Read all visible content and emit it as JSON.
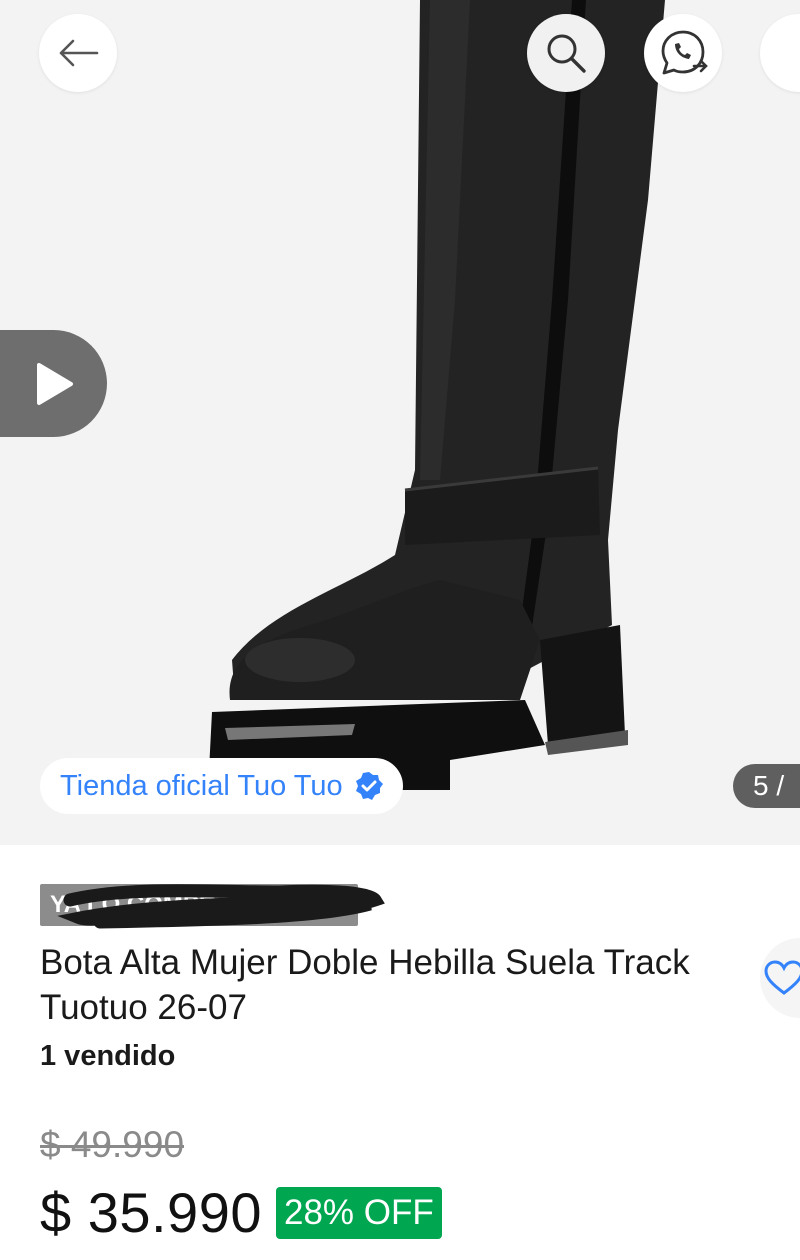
{
  "gallery": {
    "store_badge": "Tienda oficial Tuo Tuo",
    "counter": "5 /"
  },
  "icons": {
    "back": "arrow-left-icon",
    "search": "search-icon",
    "share": "whatsapp-share-icon",
    "more": "more-icon",
    "play": "play-icon",
    "verified": "verified-badge-icon",
    "favorite": "heart-icon"
  },
  "product": {
    "promo_tag": "YA LO COMPRASTE",
    "title": "Bota Alta Mujer Doble Hebilla Suela Track Tuotuo 26-07",
    "sold": "1 vendido",
    "old_price": "$ 49.990",
    "price": "$ 35.990",
    "discount": "28% OFF"
  },
  "colors": {
    "link_blue": "#3483fa",
    "discount_green": "#00a650",
    "gallery_bg": "#f3f3f3"
  }
}
